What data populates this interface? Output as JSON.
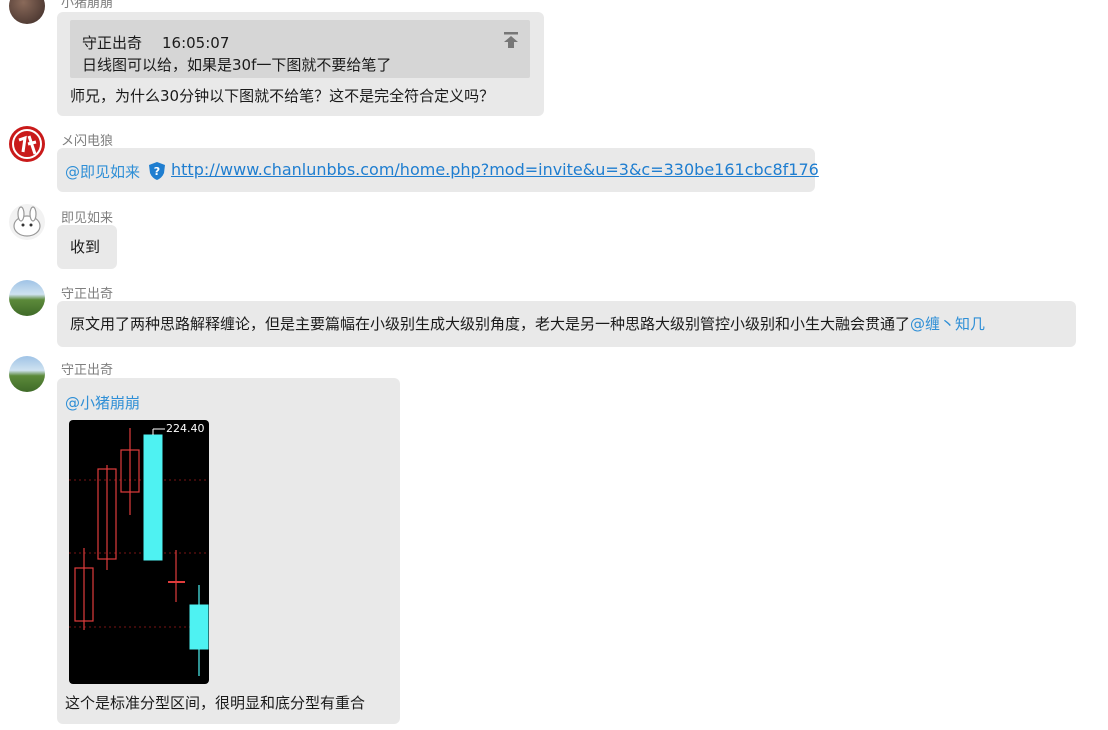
{
  "messages": [
    {
      "sender": "小猪崩崩",
      "quote": {
        "author": "守正出奇",
        "time": "16:05:07",
        "text": "日线图可以给，如果是30f一下图就不要给笔了"
      },
      "text": "师兄，为什么30分钟以下图就不给笔？这不是完全符合定义吗？"
    },
    {
      "sender": "メ闪电狼",
      "mention": "@即见如来",
      "link": "http://www.chanlunbbs.com/home.php?mod=invite&u=3&c=330be161cbc8f176"
    },
    {
      "sender": "即见如来",
      "text": "收到"
    },
    {
      "sender": "守正出奇",
      "text": "原文用了两种思路解释缠论，但是主要篇幅在小级别生成大级别角度，老大是另一种思路大级别管控小级别和小生大融会贯通了",
      "mention": "@缠丶知几"
    },
    {
      "sender": "守正出奇",
      "mention": "@小猪崩崩",
      "chart_label": "224.40",
      "text": "这个是标准分型区间，很明显和底分型有重合"
    }
  ],
  "colors": {
    "bubble": "#e9e9e9",
    "quote_bg": "#d6d6d6",
    "mention": "#2f8fd6",
    "link": "#1f7ed0",
    "candle_up": "#e03c3c",
    "candle_down": "#4ef2f2"
  },
  "icons": {
    "pin": "pin-top-icon",
    "verified": "shield-verified-icon"
  }
}
